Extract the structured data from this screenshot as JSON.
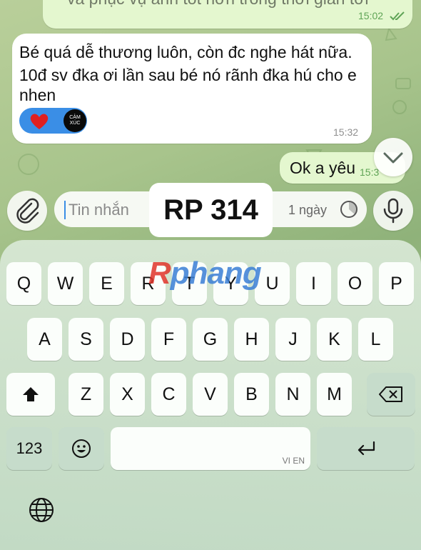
{
  "messages": [
    {
      "type": "out",
      "text": "và phục vụ anh tốt hơn trong thời gian tới",
      "time": "15:02",
      "status": "read"
    },
    {
      "type": "in",
      "text_lines": [
        "Bé quá dễ thương luôn, còn đc nghe hát nữa.",
        "10đ sv đka ơi lần sau bé nó rãnh đka hú cho e",
        "nhen"
      ],
      "time": "15:32",
      "reaction": {
        "emoji": "heart",
        "label_line1": "CẢM",
        "label_line2": "XÚC"
      }
    },
    {
      "type": "out",
      "text": "Ok a yêu",
      "time": "15:3"
    }
  ],
  "composer": {
    "placeholder": "Tin nhắn",
    "timer": "1 ngày"
  },
  "overlay_label": "RP 314",
  "watermark": {
    "first": "R",
    "rest": "phang"
  },
  "keyboard": {
    "row1": [
      "Q",
      "W",
      "E",
      "R",
      "T",
      "Y",
      "U",
      "I",
      "O",
      "P"
    ],
    "row2": [
      "A",
      "S",
      "D",
      "F",
      "G",
      "H",
      "J",
      "K",
      "L"
    ],
    "row3": [
      "Z",
      "X",
      "C",
      "V",
      "B",
      "N",
      "M"
    ],
    "numbers_label": "123",
    "space_label": "VI EN"
  },
  "colors": {
    "outgoing_bubble": "#e4f7cf",
    "incoming_bubble": "#ffffff",
    "accent": "#3a8ee6"
  },
  "icons": [
    "check-double-icon",
    "heart-icon",
    "chevron-down-icon",
    "paperclip-icon",
    "timer-icon",
    "mic-icon",
    "shift-icon",
    "backspace-icon",
    "emoji-icon",
    "return-icon",
    "globe-icon"
  ]
}
